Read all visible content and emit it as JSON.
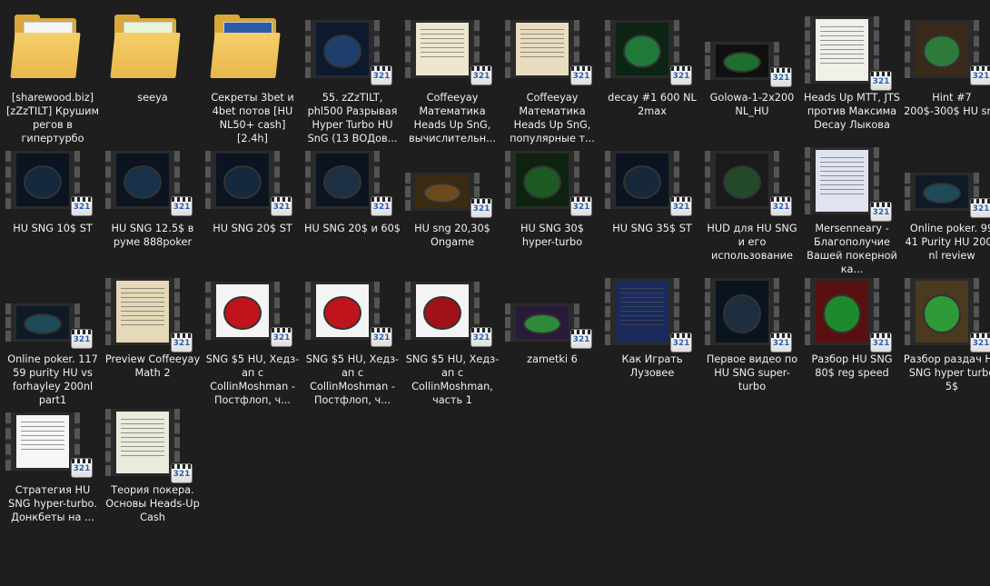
{
  "items": [
    {
      "type": "folder",
      "label": "[sharewood.biz] [zZzTILT] Крушим регов в гипертурбо",
      "paper": "#f5f5f5"
    },
    {
      "type": "folder",
      "label": "seeya",
      "paper": "#e8f4d8"
    },
    {
      "type": "folder",
      "label": "Секреты 3bet и 4bet потов [HU NL50+ cash] [2.4h]",
      "paper": "#2b5aa8"
    },
    {
      "type": "video",
      "label": "55. zZzTILT, phl500 Разрывая Hyper Turbo HU SnG (13 ВОДов...",
      "screen": "#0d1a2e",
      "felt": "#1e3f6e"
    },
    {
      "type": "video",
      "label": "Coffeeyay Математика Heads Up SnG, вычислительн...",
      "screen": "#efe6cf",
      "felt": "",
      "doc": true
    },
    {
      "type": "video",
      "label": "Coffeeyay Математика Heads Up SnG, популярные т...",
      "screen": "#e9dcc0",
      "felt": "",
      "doc": true
    },
    {
      "type": "video",
      "label": "decay #1 600 NL 2max",
      "screen": "#0c2414",
      "felt": "#1f7a3a"
    },
    {
      "type": "video",
      "label": "Golowa-1-2x200 NL_HU",
      "screen": "#101010",
      "felt": "#1e6e2e",
      "wide": true
    },
    {
      "type": "video",
      "label": "Heads Up MTT, JTS против Максима Decay Лыкова",
      "screen": "#f0efe8",
      "felt": "",
      "doc": true,
      "tall": true
    },
    {
      "type": "video",
      "label": "Hint #7 200$-300$ HU sng",
      "screen": "#3a2a1a",
      "felt": "#2d7a3a"
    },
    {
      "type": "video",
      "label": "HU SNG 10$ ST",
      "screen": "#0b1420",
      "felt": "#14283e"
    },
    {
      "type": "video",
      "label": "HU SNG 12.5$ в руме 888poker",
      "screen": "#0b1420",
      "felt": "#17314a"
    },
    {
      "type": "video",
      "label": "HU SNG 20$ ST",
      "screen": "#0b1420",
      "felt": "#14283e"
    },
    {
      "type": "video",
      "label": "HU SNG 20$ и 60$",
      "screen": "#0b1420",
      "felt": "#1c2f44"
    },
    {
      "type": "video",
      "label": "HU sng 20,30$ Ongame",
      "screen": "#3a2a12",
      "felt": "#6b4a1e",
      "wide": true
    },
    {
      "type": "video",
      "label": "HU SNG 30$ hyper-turbo",
      "screen": "#0e2210",
      "felt": "#1e5a24"
    },
    {
      "type": "video",
      "label": "HU SNG 35$ ST",
      "screen": "#0b1420",
      "felt": "#17283a"
    },
    {
      "type": "video",
      "label": "HUD для HU SNG и его использование",
      "screen": "#1a1a1a",
      "felt": "#234a2a"
    },
    {
      "type": "video",
      "label": "Mersenneary - Благополучие Вашей покерной ка...",
      "screen": "#dfe4f0",
      "felt": "",
      "doc": true,
      "tall": true
    },
    {
      "type": "video",
      "label": "Online poker. 99 41 Purity HU 200e nl review",
      "screen": "#0e1a26",
      "felt": "#1e4a5a",
      "wide": true
    },
    {
      "type": "video",
      "label": "Online poker. 117 59 purity HU vs forhayley 200nl part1",
      "screen": "#0e1a26",
      "felt": "#1e4a5a",
      "wide": true
    },
    {
      "type": "video",
      "label": "Preview Coffeeyay Math 2",
      "screen": "#e6d9b8",
      "felt": "",
      "doc": true,
      "tall": true
    },
    {
      "type": "video",
      "label": "SNG $5 HU, Хедз-ап с CollinMoshman - Постфлоп, ч...",
      "screen": "#f4f4f4",
      "felt": "#c0141c"
    },
    {
      "type": "video",
      "label": "SNG $5 HU, Хедз-ап с CollinMoshman - Постфлоп, ч...",
      "screen": "#f4f4f4",
      "felt": "#c0141c"
    },
    {
      "type": "video",
      "label": "SNG $5 HU, Хедз-ап с CollinMoshman, часть 1",
      "screen": "#f4f4f4",
      "felt": "#a01218"
    },
    {
      "type": "video",
      "label": "zametki 6",
      "screen": "#2a1a3a",
      "felt": "#2e8a3a",
      "wide": true
    },
    {
      "type": "video",
      "label": "Как Играть Лузовее",
      "screen": "#1a2a5a",
      "felt": "",
      "doc": true,
      "tall": true
    },
    {
      "type": "video",
      "label": "Первое видео по HU SNG super-turbo",
      "screen": "#0a1420",
      "felt": "#1e2e3e",
      "tall": true
    },
    {
      "type": "video",
      "label": "Разбор HU SNG 80$ reg speed",
      "screen": "#5a1010",
      "felt": "#1e8a2e",
      "tall": true
    },
    {
      "type": "video",
      "label": "Разбор раздач HU SNG hyper turbo 5$",
      "screen": "#4a3a20",
      "felt": "#2e9a3a",
      "tall": true
    },
    {
      "type": "video",
      "label": "Стратегия HU SNG hyper-turbo. Донкбеты на ...",
      "screen": "#f6f6f6",
      "felt": "",
      "doc": true
    },
    {
      "type": "video",
      "label": "Теория покера. Основы Heads-Up Cash",
      "screen": "#e8ecdc",
      "felt": "",
      "doc": true,
      "tall": true
    }
  ],
  "badge_text": "321"
}
